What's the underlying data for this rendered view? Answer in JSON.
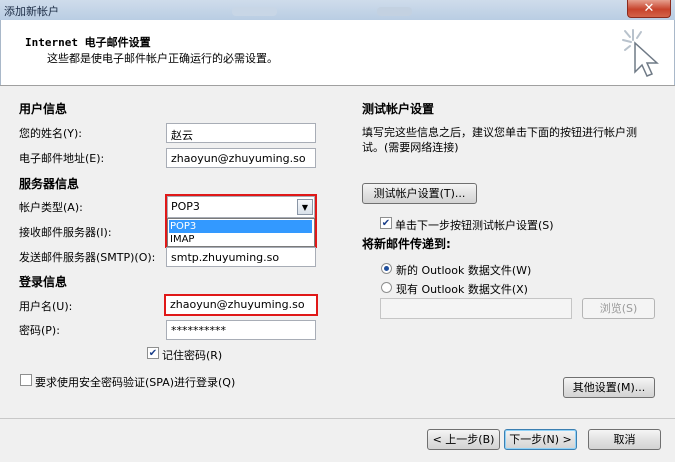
{
  "window": {
    "title": "添加新帐户",
    "close_label": "✕"
  },
  "header": {
    "title": "Internet 电子邮件设置",
    "subtitle": "这些都是使电子邮件帐户正确运行的必需设置。"
  },
  "user_info": {
    "section": "用户信息",
    "name_label": "您的姓名(Y):",
    "name_value": "赵云",
    "email_label": "电子邮件地址(E):",
    "email_value": "zhaoyun@zhuyuming.so"
  },
  "server_info": {
    "section": "服务器信息",
    "account_type_label": "帐户类型(A):",
    "account_type_value": "POP3",
    "account_type_options": [
      "POP3",
      "IMAP"
    ],
    "incoming_label": "接收邮件服务器(I):",
    "outgoing_label": "发送邮件服务器(SMTP)(O):",
    "outgoing_value": "smtp.zhuyuming.so"
  },
  "login_info": {
    "section": "登录信息",
    "username_label": "用户名(U):",
    "username_value": "zhaoyun@zhuyuming.so",
    "password_label": "密码(P):",
    "password_value": "**********",
    "remember_label": "记住密码(R)",
    "remember_checked": true,
    "spa_label": "要求使用安全密码验证(SPA)进行登录(Q)",
    "spa_checked": false
  },
  "test_settings": {
    "section": "测试帐户设置",
    "description": "填写完这些信息之后，建议您单击下面的按钮进行帐户测试。(需要网络连接)",
    "test_button": "测试帐户设置(T)...",
    "auto_test_label": "单击下一步按钮测试帐户设置(S)",
    "auto_test_checked": true,
    "deliver_section": "将新邮件传递到:",
    "new_file_label": "新的 Outlook 数据文件(W)",
    "existing_file_label": "现有 Outlook 数据文件(X)",
    "browse_button": "浏览(S)",
    "other_settings_button": "其他设置(M)..."
  },
  "footer": {
    "back_button": "< 上一步(B)",
    "next_button": "下一步(N) >",
    "cancel_button": "取消"
  }
}
